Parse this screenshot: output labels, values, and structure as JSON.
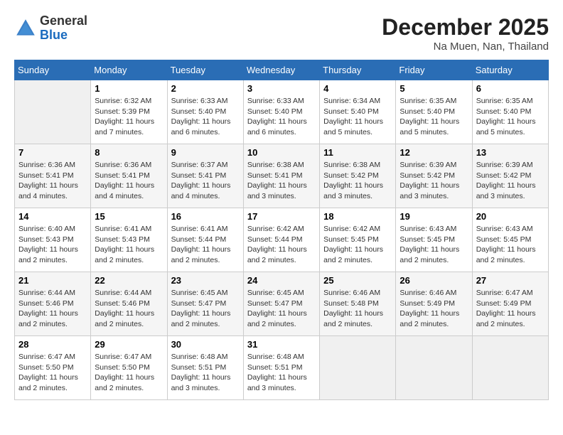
{
  "header": {
    "logo_general": "General",
    "logo_blue": "Blue",
    "month": "December 2025",
    "location": "Na Muen, Nan, Thailand"
  },
  "weekdays": [
    "Sunday",
    "Monday",
    "Tuesday",
    "Wednesday",
    "Thursday",
    "Friday",
    "Saturday"
  ],
  "weeks": [
    [
      {
        "day": "",
        "sunrise": "",
        "sunset": "",
        "daylight": ""
      },
      {
        "day": "1",
        "sunrise": "Sunrise: 6:32 AM",
        "sunset": "Sunset: 5:39 PM",
        "daylight": "Daylight: 11 hours and 7 minutes."
      },
      {
        "day": "2",
        "sunrise": "Sunrise: 6:33 AM",
        "sunset": "Sunset: 5:40 PM",
        "daylight": "Daylight: 11 hours and 6 minutes."
      },
      {
        "day": "3",
        "sunrise": "Sunrise: 6:33 AM",
        "sunset": "Sunset: 5:40 PM",
        "daylight": "Daylight: 11 hours and 6 minutes."
      },
      {
        "day": "4",
        "sunrise": "Sunrise: 6:34 AM",
        "sunset": "Sunset: 5:40 PM",
        "daylight": "Daylight: 11 hours and 5 minutes."
      },
      {
        "day": "5",
        "sunrise": "Sunrise: 6:35 AM",
        "sunset": "Sunset: 5:40 PM",
        "daylight": "Daylight: 11 hours and 5 minutes."
      },
      {
        "day": "6",
        "sunrise": "Sunrise: 6:35 AM",
        "sunset": "Sunset: 5:40 PM",
        "daylight": "Daylight: 11 hours and 5 minutes."
      }
    ],
    [
      {
        "day": "7",
        "sunrise": "Sunrise: 6:36 AM",
        "sunset": "Sunset: 5:41 PM",
        "daylight": "Daylight: 11 hours and 4 minutes."
      },
      {
        "day": "8",
        "sunrise": "Sunrise: 6:36 AM",
        "sunset": "Sunset: 5:41 PM",
        "daylight": "Daylight: 11 hours and 4 minutes."
      },
      {
        "day": "9",
        "sunrise": "Sunrise: 6:37 AM",
        "sunset": "Sunset: 5:41 PM",
        "daylight": "Daylight: 11 hours and 4 minutes."
      },
      {
        "day": "10",
        "sunrise": "Sunrise: 6:38 AM",
        "sunset": "Sunset: 5:41 PM",
        "daylight": "Daylight: 11 hours and 3 minutes."
      },
      {
        "day": "11",
        "sunrise": "Sunrise: 6:38 AM",
        "sunset": "Sunset: 5:42 PM",
        "daylight": "Daylight: 11 hours and 3 minutes."
      },
      {
        "day": "12",
        "sunrise": "Sunrise: 6:39 AM",
        "sunset": "Sunset: 5:42 PM",
        "daylight": "Daylight: 11 hours and 3 minutes."
      },
      {
        "day": "13",
        "sunrise": "Sunrise: 6:39 AM",
        "sunset": "Sunset: 5:42 PM",
        "daylight": "Daylight: 11 hours and 3 minutes."
      }
    ],
    [
      {
        "day": "14",
        "sunrise": "Sunrise: 6:40 AM",
        "sunset": "Sunset: 5:43 PM",
        "daylight": "Daylight: 11 hours and 2 minutes."
      },
      {
        "day": "15",
        "sunrise": "Sunrise: 6:41 AM",
        "sunset": "Sunset: 5:43 PM",
        "daylight": "Daylight: 11 hours and 2 minutes."
      },
      {
        "day": "16",
        "sunrise": "Sunrise: 6:41 AM",
        "sunset": "Sunset: 5:44 PM",
        "daylight": "Daylight: 11 hours and 2 minutes."
      },
      {
        "day": "17",
        "sunrise": "Sunrise: 6:42 AM",
        "sunset": "Sunset: 5:44 PM",
        "daylight": "Daylight: 11 hours and 2 minutes."
      },
      {
        "day": "18",
        "sunrise": "Sunrise: 6:42 AM",
        "sunset": "Sunset: 5:45 PM",
        "daylight": "Daylight: 11 hours and 2 minutes."
      },
      {
        "day": "19",
        "sunrise": "Sunrise: 6:43 AM",
        "sunset": "Sunset: 5:45 PM",
        "daylight": "Daylight: 11 hours and 2 minutes."
      },
      {
        "day": "20",
        "sunrise": "Sunrise: 6:43 AM",
        "sunset": "Sunset: 5:45 PM",
        "daylight": "Daylight: 11 hours and 2 minutes."
      }
    ],
    [
      {
        "day": "21",
        "sunrise": "Sunrise: 6:44 AM",
        "sunset": "Sunset: 5:46 PM",
        "daylight": "Daylight: 11 hours and 2 minutes."
      },
      {
        "day": "22",
        "sunrise": "Sunrise: 6:44 AM",
        "sunset": "Sunset: 5:46 PM",
        "daylight": "Daylight: 11 hours and 2 minutes."
      },
      {
        "day": "23",
        "sunrise": "Sunrise: 6:45 AM",
        "sunset": "Sunset: 5:47 PM",
        "daylight": "Daylight: 11 hours and 2 minutes."
      },
      {
        "day": "24",
        "sunrise": "Sunrise: 6:45 AM",
        "sunset": "Sunset: 5:47 PM",
        "daylight": "Daylight: 11 hours and 2 minutes."
      },
      {
        "day": "25",
        "sunrise": "Sunrise: 6:46 AM",
        "sunset": "Sunset: 5:48 PM",
        "daylight": "Daylight: 11 hours and 2 minutes."
      },
      {
        "day": "26",
        "sunrise": "Sunrise: 6:46 AM",
        "sunset": "Sunset: 5:49 PM",
        "daylight": "Daylight: 11 hours and 2 minutes."
      },
      {
        "day": "27",
        "sunrise": "Sunrise: 6:47 AM",
        "sunset": "Sunset: 5:49 PM",
        "daylight": "Daylight: 11 hours and 2 minutes."
      }
    ],
    [
      {
        "day": "28",
        "sunrise": "Sunrise: 6:47 AM",
        "sunset": "Sunset: 5:50 PM",
        "daylight": "Daylight: 11 hours and 2 minutes."
      },
      {
        "day": "29",
        "sunrise": "Sunrise: 6:47 AM",
        "sunset": "Sunset: 5:50 PM",
        "daylight": "Daylight: 11 hours and 2 minutes."
      },
      {
        "day": "30",
        "sunrise": "Sunrise: 6:48 AM",
        "sunset": "Sunset: 5:51 PM",
        "daylight": "Daylight: 11 hours and 3 minutes."
      },
      {
        "day": "31",
        "sunrise": "Sunrise: 6:48 AM",
        "sunset": "Sunset: 5:51 PM",
        "daylight": "Daylight: 11 hours and 3 minutes."
      },
      {
        "day": "",
        "sunrise": "",
        "sunset": "",
        "daylight": ""
      },
      {
        "day": "",
        "sunrise": "",
        "sunset": "",
        "daylight": ""
      },
      {
        "day": "",
        "sunrise": "",
        "sunset": "",
        "daylight": ""
      }
    ]
  ]
}
